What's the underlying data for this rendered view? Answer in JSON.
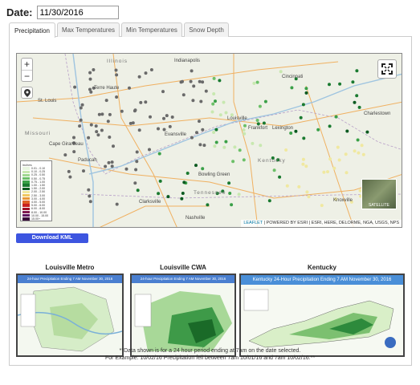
{
  "date": {
    "label": "Date:",
    "value": "11/30/2016"
  },
  "tabs": [
    {
      "label": "Precipitation",
      "active": true
    },
    {
      "label": "Max Temperatures",
      "active": false
    },
    {
      "label": "Min Temperatures",
      "active": false
    },
    {
      "label": "Snow Depth",
      "active": false
    }
  ],
  "map": {
    "zoom_in": "+",
    "zoom_out": "−",
    "satellite_label": "SATELLITE",
    "attribution_link": "LEAFLET",
    "attribution_text": "| POWERED BY ESRI | ESRI, HERE, DELORME, NGA, USGS, NPS",
    "cities": [
      "Illinois",
      "Cincinnati",
      "Indianapolis",
      "St. Louis",
      "Evansville",
      "Frankfort",
      "Lexington",
      "Louisville",
      "Charlestown",
      "Bowling Green",
      "Clarksville",
      "Nashville",
      "Knoxville",
      "Paducah",
      "Cape Girardeau",
      "Terre Haute"
    ],
    "states": [
      "Missouri",
      "Kentucky",
      "Tennessee"
    ],
    "legend": {
      "title": "inches",
      "items": [
        {
          "label": "0.01 - 0.10",
          "color": "#e8f5e0"
        },
        {
          "label": "0.10 - 0.25",
          "color": "#c8e8b0"
        },
        {
          "label": "0.25 - 0.50",
          "color": "#a0d890"
        },
        {
          "label": "0.50 - 0.75",
          "color": "#6cc068"
        },
        {
          "label": "0.75 - 1.00",
          "color": "#3aa048"
        },
        {
          "label": "1.00 - 1.50",
          "color": "#1a7a30"
        },
        {
          "label": "1.50 - 2.00",
          "color": "#0a5a20"
        },
        {
          "label": "2.00 - 2.50",
          "color": "#f0e8a0"
        },
        {
          "label": "2.50 - 3.00",
          "color": "#f0c860"
        },
        {
          "label": "3.00 - 4.00",
          "color": "#e89838"
        },
        {
          "label": "4.00 - 5.00",
          "color": "#e06028"
        },
        {
          "label": "5.00 - 6.00",
          "color": "#c82020"
        },
        {
          "label": "6.00 - 8.00",
          "color": "#a01028"
        },
        {
          "label": "8.00 - 10.00",
          "color": "#801850"
        },
        {
          "label": "10.00 - 15.00",
          "color": "#601060"
        },
        {
          "label": "15.00+",
          "color": "#380838"
        }
      ]
    }
  },
  "download_kml": "Download KML",
  "thumbnails": [
    {
      "title": "Louisville Metro",
      "header": "24-hour Precipitation Ending 7 AM November 30, 2016"
    },
    {
      "title": "Louisville CWA",
      "header": "24-hour Precipitation Ending 7 AM November 30, 2016"
    },
    {
      "title": "Kentucky",
      "header": "Kentucky 24-Hour Precipitation Ending 7 AM November 30, 2016"
    }
  ],
  "footnote": {
    "line1": "**Data shown is for a 24 hour period ending at 7am on the date selected.",
    "line2": "For Example: 10/02/16 Precipitation fell between 7am 10/01/16 and 7am 10/02/16.**"
  }
}
